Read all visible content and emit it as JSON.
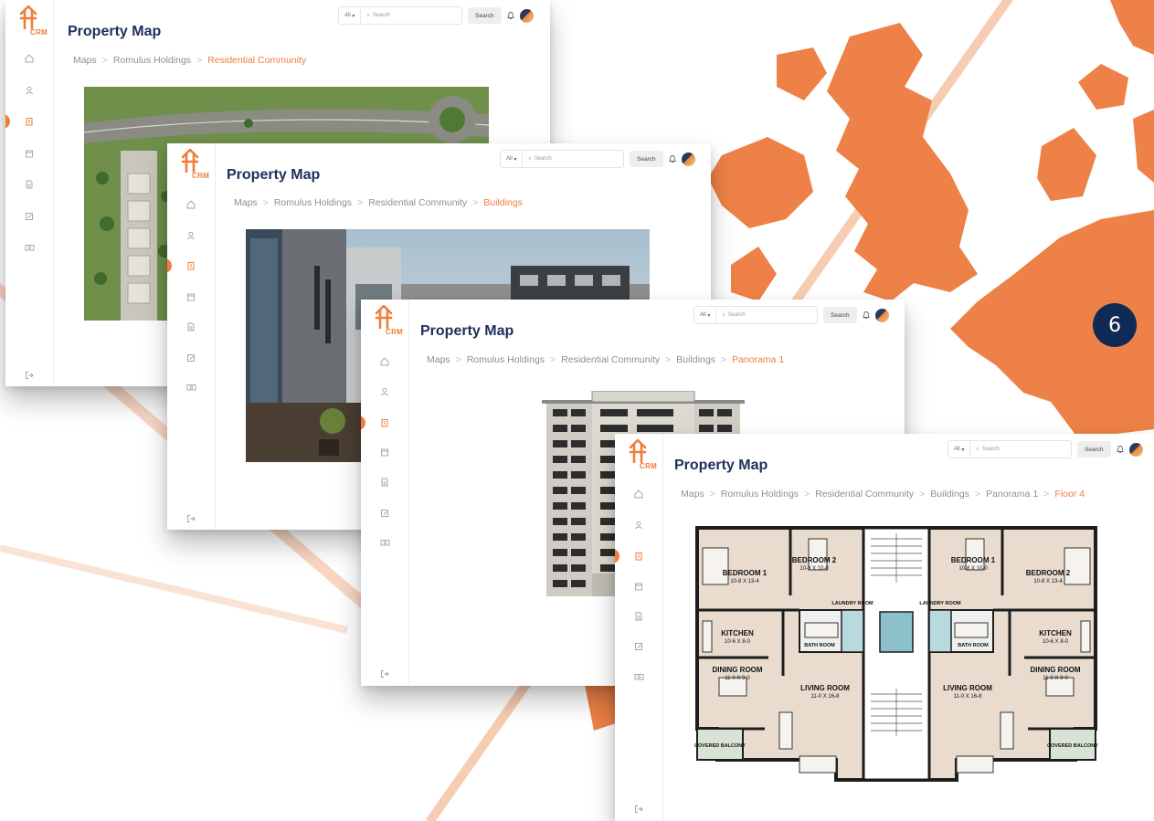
{
  "app": {
    "title": "Property Map",
    "brand": "CRM",
    "accent_color": "#ef7d3c",
    "title_color": "#1f2e5a"
  },
  "header": {
    "filter_label": "All",
    "search_placeholder": "Search",
    "search_button": "Search"
  },
  "slide_number": "6",
  "nav_icons": [
    "home-icon",
    "users-icon",
    "building-icon",
    "calendar-icon",
    "document-icon",
    "edit-icon",
    "money-icon",
    "logout-icon"
  ],
  "windows": [
    {
      "breadcrumb": [
        "Maps",
        "Romulus Holdings",
        "Residential Community"
      ],
      "image": "aerial-site-plan"
    },
    {
      "breadcrumb": [
        "Maps",
        "Romulus Holdings",
        "Residential Community",
        "Buildings"
      ],
      "image": "building-photo"
    },
    {
      "breadcrumb": [
        "Maps",
        "Romulus Holdings",
        "Residential Community",
        "Buildings",
        "Panorama 1"
      ],
      "image": "building-facade"
    },
    {
      "breadcrumb": [
        "Maps",
        "Romulus Holdings",
        "Residential Community",
        "Buildings",
        "Panorama 1",
        "Floor 4"
      ],
      "image": "floor-plan"
    }
  ],
  "floor_plan": {
    "rooms": [
      {
        "name": "BEDROOM 1",
        "size": "10-8 X 13-4"
      },
      {
        "name": "BEDROOM 2",
        "size": "10-8 X 10-0"
      },
      {
        "name": "BEDROOM 1",
        "size": "10-8 X 10-0"
      },
      {
        "name": "BEDROOM 2",
        "size": "10-8 X 13-4"
      },
      {
        "name": "KITCHEN",
        "size": "10-6 X 8-0"
      },
      {
        "name": "BATH ROOM"
      },
      {
        "name": "LAUNDRY ROOM"
      },
      {
        "name": "LAUNDRY ROOM"
      },
      {
        "name": "BATH ROOM"
      },
      {
        "name": "KITCHEN",
        "size": "10-6 X 8-0"
      },
      {
        "name": "DINING ROOM",
        "size": "11-0 X 9-0"
      },
      {
        "name": "LIVING ROOM",
        "size": "11-0 X 16-8"
      },
      {
        "name": "LIVING ROOM",
        "size": "11-0 X 16-8"
      },
      {
        "name": "DINING ROOM",
        "size": "11-0 X 9-0"
      },
      {
        "name": "COVERED BALCONY"
      },
      {
        "name": "COVERED BALCONY"
      }
    ]
  }
}
